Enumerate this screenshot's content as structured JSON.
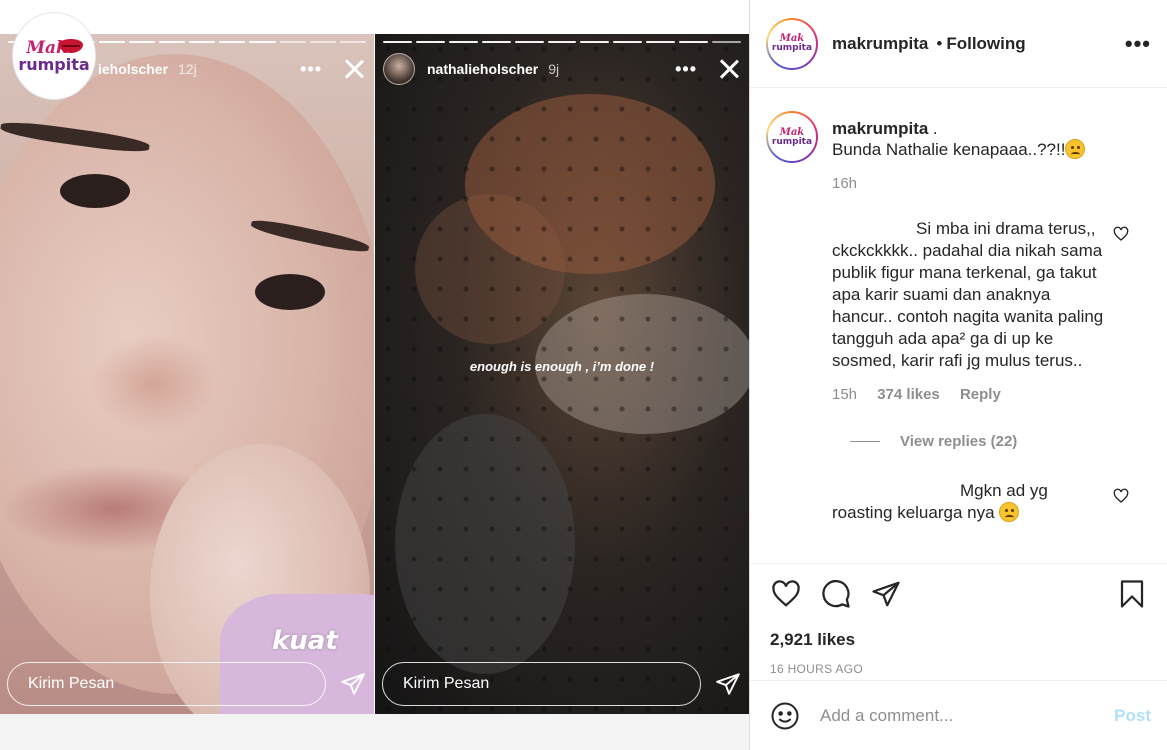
{
  "stories": [
    {
      "username_clip": "ieholscher",
      "time": "12j",
      "sticker": "kuat",
      "reply_placeholder": "Kirim Pesan"
    },
    {
      "username": "nathalieholscher",
      "time": "9j",
      "caption": "enough is enough , i’m done !",
      "reply_placeholder": "Kirim Pesan"
    }
  ],
  "logo": {
    "line1": "Mak",
    "line2": "rumpita"
  },
  "post": {
    "header": {
      "username": "makrumpita",
      "dot": "•",
      "follow_label": "Following"
    },
    "caption": {
      "author": "makrumpita",
      "author_suffix": ".",
      "text": "Bunda Nathalie kenapaaa..??!!",
      "time": "16h"
    },
    "comments": [
      {
        "text": "Si mba ini drama terus,, ckckckkkk.. padahal dia nikah sama publik figur mana terkenal, ga takut apa karir suami dan anaknya hancur.. contoh nagita wanita paling tangguh ada apa² ga di up ke sosmed, karir rafi jg mulus terus..",
        "time": "15h",
        "likes": "374 likes",
        "reply_label": "Reply",
        "view_replies": "View replies (22)"
      },
      {
        "text": "Mgkn ad yg roasting keluarga nya"
      }
    ],
    "likes": "2,921 likes",
    "posted": "16 HOURS AGO",
    "add_comment_placeholder": "Add a comment...",
    "post_label": "Post"
  },
  "icons": [
    "heart-icon",
    "comment-icon",
    "share-icon",
    "bookmark-icon",
    "emoji-icon",
    "close-icon",
    "send-icon",
    "more-icon"
  ],
  "colors": {
    "post_button": "#b2dffc",
    "muted": "#8e8e8e",
    "text": "#262626"
  }
}
